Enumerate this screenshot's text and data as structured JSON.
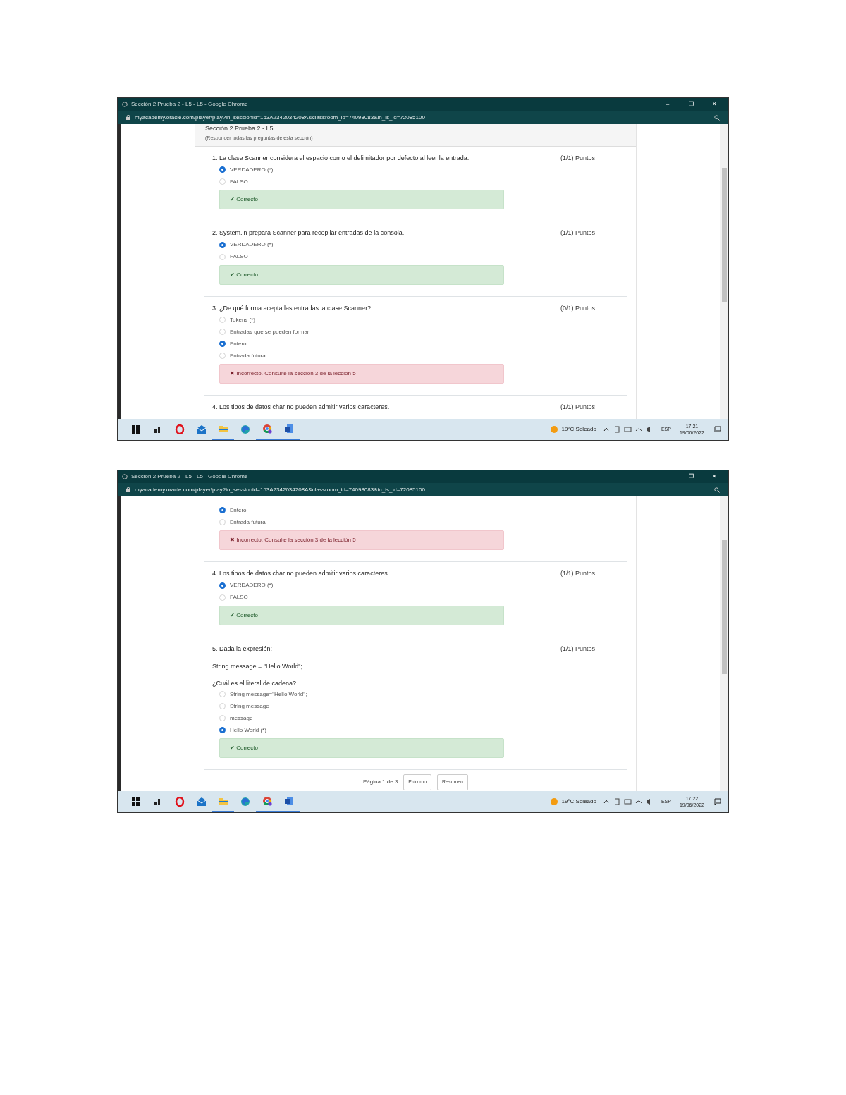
{
  "screenshots": [
    {
      "window": {
        "title": "Sección 2 Prueba 2 - L5 - L5 - Google Chrome",
        "url": "myacademy.oracle.com/player/play?in_sessionid=153A2342034208A&classroom_id=74098083&in_is_id=72085100",
        "controls": [
          "–",
          "❐",
          "✕"
        ]
      },
      "section": {
        "title": "Sección 2 Prueba 2 - L5",
        "subtitle": "(Responder todas las preguntas de esta sección)"
      },
      "blocks": [
        {
          "question": "1. La clase Scanner considera el espacio como el delimitador por defecto al leer la entrada.",
          "points": "(1/1) Puntos",
          "options": [
            {
              "label": "VERDADERO (*)",
              "selected": true
            },
            {
              "label": "FALSO",
              "selected": false
            }
          ],
          "feedback": {
            "kind": "correct",
            "icon": "✔",
            "text": "Correcto"
          }
        },
        {
          "question": "2. System.in prepara Scanner para recopilar entradas de la consola.",
          "points": "(1/1) Puntos",
          "options": [
            {
              "label": "VERDADERO (*)",
              "selected": true
            },
            {
              "label": "FALSO",
              "selected": false
            }
          ],
          "feedback": {
            "kind": "correct",
            "icon": "✔",
            "text": "Correcto"
          }
        },
        {
          "question": "3. ¿De qué forma acepta las entradas la clase Scanner?",
          "points": "(0/1) Puntos",
          "options": [
            {
              "label": "Tokens (*)",
              "selected": false
            },
            {
              "label": "Entradas que se pueden formar",
              "selected": false
            },
            {
              "label": "Entero",
              "selected": true
            },
            {
              "label": "Entrada futura",
              "selected": false
            }
          ],
          "feedback": {
            "kind": "incorrect",
            "icon": "✖",
            "text": "Incorrecto. Consulte la sección 3 de la lección 5"
          }
        },
        {
          "question": "4. Los tipos de datos char no pueden admitir varios caracteres.",
          "points": "(1/1) Puntos"
        }
      ],
      "taskbar": {
        "weather": "19°C Soleado",
        "lang": "ESP",
        "time": "17:21",
        "date": "19/06/2022"
      }
    },
    {
      "window": {
        "title": "Sección 2 Prueba 2 - L5 - L5 - Google Chrome",
        "url": "myacademy.oracle.com/player/play?in_sessionid=153A2342034208A&classroom_id=74098083&in_is_id=72085100",
        "controls": [
          "❐",
          "✕"
        ]
      },
      "blocks": [
        {
          "options": [
            {
              "label": "Entero",
              "selected": true
            },
            {
              "label": "Entrada futura",
              "selected": false
            }
          ],
          "feedback": {
            "kind": "incorrect",
            "icon": "✖",
            "text": "Incorrecto. Consulte la sección 3 de la lección 5"
          }
        },
        {
          "question": "4. Los tipos de datos char no pueden admitir varios caracteres.",
          "points": "(1/1) Puntos",
          "options": [
            {
              "label": "VERDADERO (*)",
              "selected": true
            },
            {
              "label": "FALSO",
              "selected": false
            }
          ],
          "feedback": {
            "kind": "correct",
            "icon": "✔",
            "text": "Correcto"
          }
        },
        {
          "question": "5. Dada la expresión:",
          "points": "(1/1) Puntos",
          "lines": [
            "String message = \"Hello World\";",
            "¿Cuál es el literal de cadena?"
          ],
          "options": [
            {
              "label": "String message=\"Hello World\";",
              "selected": false
            },
            {
              "label": "String message",
              "selected": false
            },
            {
              "label": "message",
              "selected": false
            },
            {
              "label": "Hello World (*)",
              "selected": true
            }
          ],
          "feedback": {
            "kind": "correct",
            "icon": "✔",
            "text": "Correcto"
          }
        }
      ],
      "pagination": {
        "label": "Página 1 de 3",
        "buttons": [
          "Próximo",
          "Resumen"
        ]
      },
      "taskbar": {
        "weather": "19°C Soleado",
        "lang": "ESP",
        "time": "17:22",
        "date": "19/06/2022"
      }
    }
  ]
}
